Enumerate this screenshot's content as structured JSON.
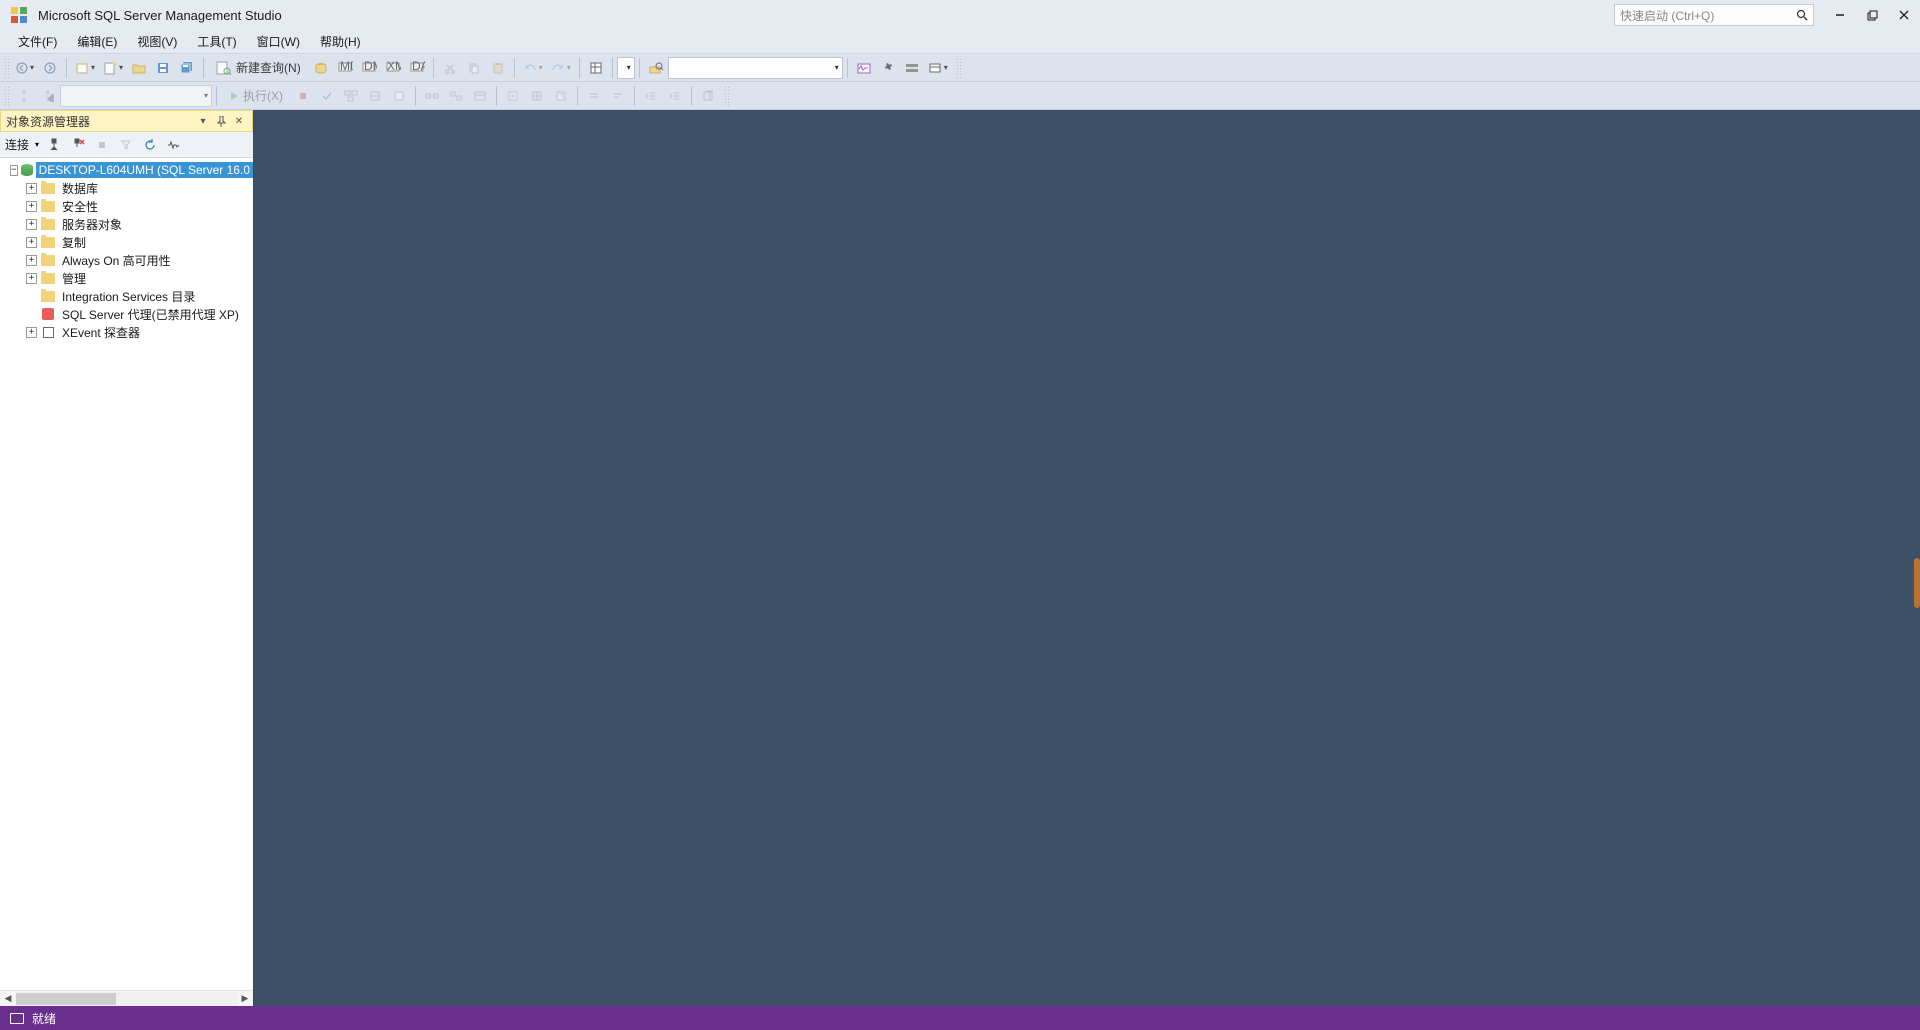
{
  "titlebar": {
    "title": "Microsoft SQL Server Management Studio",
    "quicklaunch_placeholder": "快速启动 (Ctrl+Q)"
  },
  "menu": {
    "file": "文件(F)",
    "edit": "编辑(E)",
    "view": "视图(V)",
    "tools": "工具(T)",
    "window": "窗口(W)",
    "help": "帮助(H)"
  },
  "toolbar": {
    "new_query": "新建查询(N)",
    "execute": "执行(X)"
  },
  "object_explorer": {
    "title": "对象资源管理器",
    "connect": "连接",
    "server": "DESKTOP-L604UMH (SQL Server 16.0",
    "nodes": {
      "databases": "数据库",
      "security": "安全性",
      "server_objects": "服务器对象",
      "replication": "复制",
      "always_on": "Always On 高可用性",
      "management": "管理",
      "integration": "Integration Services 目录",
      "agent": "SQL Server 代理(已禁用代理 XP)",
      "xevent": "XEvent 探查器"
    }
  },
  "statusbar": {
    "ready": "就绪"
  }
}
